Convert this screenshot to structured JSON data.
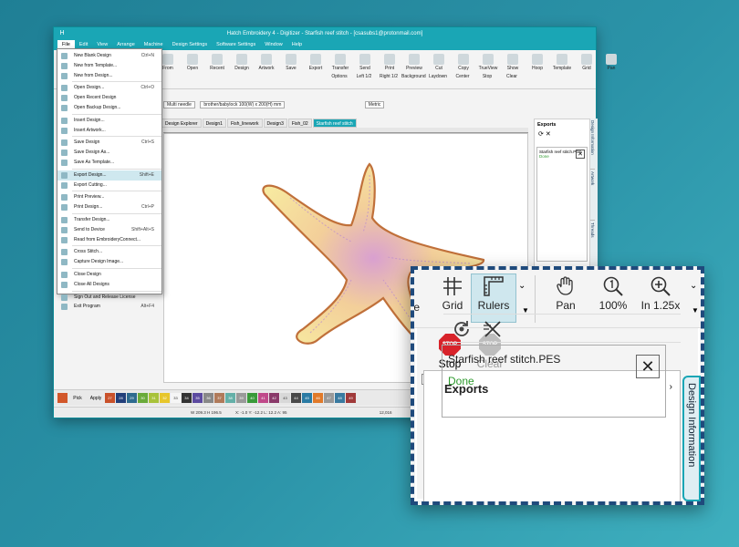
{
  "window": {
    "title": "Hatch Embroidery 4 - Digitizer - Starfish reef stitch - [csasubs1@protonmail.com]",
    "app_icon": "H"
  },
  "menubar": [
    "File",
    "Edit",
    "View",
    "Arrange",
    "Machine",
    "Design Settings",
    "Software Settings",
    "Window",
    "Help"
  ],
  "ribbon": {
    "buttons": [
      "From",
      "Open",
      "Recent",
      "Design",
      "Artwork",
      "Save",
      "Export",
      "Transfer",
      "Send",
      "Print",
      "Preview",
      "Cut",
      "Copy",
      "TrueView",
      "Show",
      "Hoop",
      "Template",
      "Grid",
      "Pan"
    ],
    "row2_buttons": [
      "Options",
      "Left 1/2",
      "Right 1/2",
      "Background",
      "Laydown",
      "Center",
      "Stop",
      "Clear"
    ],
    "needle": "Multi needle",
    "hoop": "brother/babylock 100(W) x 200(H) mm",
    "units": "Metric"
  },
  "doc_tabs": [
    "Design Explorer",
    "Design1",
    "Fish_linework",
    "Design3",
    "Fish_02",
    "Starfish reef stitch"
  ],
  "file_menu": [
    {
      "label": "New Blank Design",
      "shortcut": "Ctrl+N"
    },
    {
      "label": "New from Template...",
      "shortcut": ""
    },
    {
      "label": "New from Design...",
      "shortcut": ""
    },
    {
      "label": "Open Design...",
      "shortcut": "Ctrl+O"
    },
    {
      "label": "Open Recent Design",
      "shortcut": ""
    },
    {
      "label": "Open Backup Design...",
      "shortcut": ""
    },
    {
      "label": "Insert Design...",
      "shortcut": ""
    },
    {
      "label": "Insert Artwork...",
      "shortcut": ""
    },
    {
      "label": "Save Design",
      "shortcut": "Ctrl+S"
    },
    {
      "label": "Save Design As...",
      "shortcut": ""
    },
    {
      "label": "Save As Template...",
      "shortcut": ""
    },
    {
      "label": "Export Design...",
      "shortcut": "Shift+E"
    },
    {
      "label": "Export Cutting...",
      "shortcut": ""
    },
    {
      "label": "Print Preview...",
      "shortcut": ""
    },
    {
      "label": "Print Design...",
      "shortcut": "Ctrl+P"
    },
    {
      "label": "Transfer Design...",
      "shortcut": ""
    },
    {
      "label": "Send to Device",
      "shortcut": "Shift+Alt+S"
    },
    {
      "label": "Read from EmbroideryConnect...",
      "shortcut": ""
    },
    {
      "label": "Cross Stitch...",
      "shortcut": ""
    },
    {
      "label": "Capture Design Image...",
      "shortcut": ""
    },
    {
      "label": "Close Design",
      "shortcut": ""
    },
    {
      "label": "Close All Designs",
      "shortcut": ""
    },
    {
      "label": "Sign Out and Release License",
      "shortcut": ""
    },
    {
      "label": "Exit Program",
      "shortcut": "Alt+F4"
    }
  ],
  "exports_panel": {
    "title": "Exports",
    "file_name": "Starfish reef stitch.PES",
    "status": "Done"
  },
  "side_tabs": [
    "Design Information",
    "Artwork",
    "Threads",
    "Sequence"
  ],
  "palette": {
    "pick_label": "Pick",
    "apply_label": "Apply",
    "swatches": [
      {
        "n": "27",
        "c": "#c9512a"
      },
      {
        "n": "28",
        "c": "#223f7a"
      },
      {
        "n": "29",
        "c": "#2e6b8f"
      },
      {
        "n": "30",
        "c": "#6aaa3a"
      },
      {
        "n": "31",
        "c": "#a8c23a"
      },
      {
        "n": "32",
        "c": "#e7c62b"
      },
      {
        "n": "33",
        "c": "#f5f5f5"
      },
      {
        "n": "34",
        "c": "#333333"
      },
      {
        "n": "35",
        "c": "#5c4aa0"
      },
      {
        "n": "36",
        "c": "#888888"
      },
      {
        "n": "37",
        "c": "#b07a5a"
      },
      {
        "n": "38",
        "c": "#64b0a8"
      },
      {
        "n": "39",
        "c": "#9a9a9a"
      },
      {
        "n": "40",
        "c": "#3a9a3a"
      },
      {
        "n": "41",
        "c": "#c04a8a"
      },
      {
        "n": "42",
        "c": "#8a3a6a"
      },
      {
        "n": "43",
        "c": "#d8d8d8"
      },
      {
        "n": "44",
        "c": "#4a4a4a"
      },
      {
        "n": "45",
        "c": "#2b7ba4"
      },
      {
        "n": "46",
        "c": "#e17a2a"
      },
      {
        "n": "47",
        "c": "#999999"
      },
      {
        "n": "48",
        "c": "#3a7aa0"
      },
      {
        "n": "49",
        "c": "#a03a3a"
      }
    ]
  },
  "statusbar": {
    "size": "W 209.3 H 196.5",
    "coords": "X: -1.0 Y: -12.2 L: 12.2 A: 95",
    "stitches": "12,016"
  },
  "zoom": {
    "buttons": [
      "Grid",
      "Rulers",
      "Pan",
      "100%",
      "In 1.25x"
    ],
    "stop": "Stop",
    "clear": "Clear",
    "panel_title": "Exports",
    "file_name": "Starfish reef stitch.PES",
    "status": "Done",
    "side_tab": "Design Information",
    "close_glyph": "✕",
    "chevron": "›"
  }
}
